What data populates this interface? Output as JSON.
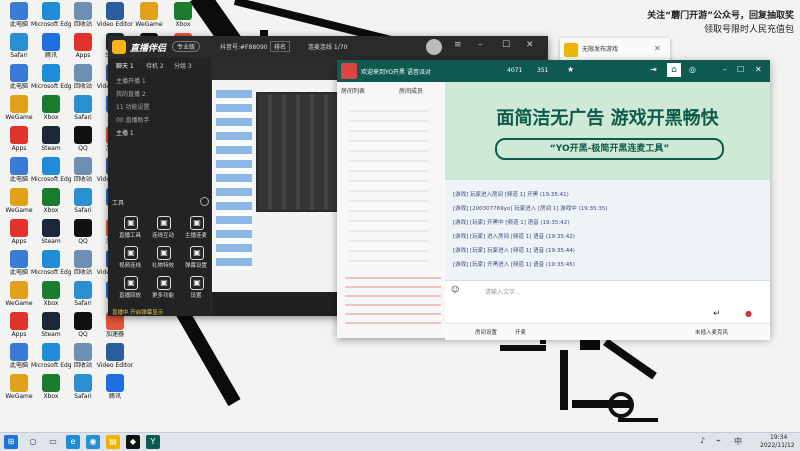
{
  "banner": {
    "line1": "关注“蘑门开游”公众号，回复抽取奖",
    "line2": "领取号限时人民充值包"
  },
  "desktop_icons": [
    {
      "label": "此电脑",
      "icon": "pc-icon",
      "color": "#3a7bd5"
    },
    {
      "label": "Microsoft Edge",
      "icon": "edge-icon",
      "color": "#1e8cd6"
    },
    {
      "label": "回收站",
      "icon": "recycle-bin-icon",
      "color": "#6d8fb3"
    },
    {
      "label": "Video Editor",
      "icon": "video-editor-icon",
      "color": "#2b5d9c"
    },
    {
      "label": "WeGame",
      "icon": "wegame-icon",
      "color": "#e0a21b"
    },
    {
      "label": "Xbox",
      "icon": "xbox-icon",
      "color": "#1b7c2f"
    },
    {
      "label": "Safari",
      "icon": "browser-icon",
      "color": "#2b8fd0"
    },
    {
      "label": "腾讯",
      "icon": "tencent-icon",
      "color": "#1f6fe0"
    },
    {
      "label": "Apps",
      "icon": "apps-icon",
      "color": "#e1322b"
    },
    {
      "label": "Steam",
      "icon": "steam-icon",
      "color": "#1b2838"
    },
    {
      "label": "QQ",
      "icon": "qq-icon",
      "color": "#111"
    },
    {
      "label": "加速器",
      "icon": "accelerator-icon",
      "color": "#e6553a"
    }
  ],
  "main_window": {
    "brand": "直播伴侣",
    "brand_badge": "专业版",
    "tabs": [
      "聊天 1",
      "待机 2",
      "分组 3"
    ],
    "title_info": "抖音号:#F88090",
    "title_tab": "排名",
    "status": "连麦连线 1/70",
    "sidebar_rows": [
      "主播开播 1",
      "我的直播 2",
      "11 功能设置",
      "00 直播助手",
      "主播 1"
    ],
    "section_label": "工具",
    "functions": [
      {
        "label": "直播工具",
        "icon": "tools-icon"
      },
      {
        "label": "连线互动",
        "icon": "link-icon"
      },
      {
        "label": "主播连麦",
        "icon": "mic-icon"
      },
      {
        "label": "视频连线",
        "icon": "video-icon"
      },
      {
        "label": "礼物特效",
        "icon": "gift-icon"
      },
      {
        "label": "弹幕设置",
        "icon": "danmu-icon"
      },
      {
        "label": "直播回放",
        "icon": "replay-icon"
      },
      {
        "label": "更多功能",
        "icon": "more-icon"
      },
      {
        "label": "设置",
        "icon": "settings-icon"
      }
    ],
    "bottom_hint": "直播中 开启弹幕显示",
    "bottom_buttons": [
      "连线",
      "画面",
      "分享"
    ]
  },
  "chat_window": {
    "title": "欢迎来到YO开黑 语音派对",
    "room_id": "4071",
    "online": "351",
    "list_header": "房间列表",
    "list_tab": "房间成员",
    "ad": {
      "headline": "面简洁无广告 游戏开黑畅快",
      "slogan": "“YO开黑-极简开黑连麦工具”"
    },
    "messages": [
      "[游戏] 玩家进入房间 [频道 1] 开黑 (19:35:41)",
      "[游戏] [200307769yo] 玩家进入 [房间 1] 游戏中 (19:35:35)",
      "[游戏] [玩家] 开黑中 [频道 1] 语音 (19:35:42)",
      "[游戏] [玩家] 进入房间 [频道 1] 语音 (19:35:42)",
      "[游戏] [玩家] 玩家进入 [频道 1] 语音 (19:35:44)",
      "[游戏] [玩家] 开黑进入 [频道 1] 语音 (19:35:45)"
    ],
    "input_placeholder": "请输入文字...",
    "bottom_items": [
      "房间设置",
      "开麦"
    ],
    "mic_status": "未插入麦克风"
  },
  "qq_window": {
    "title": "无限发布游戏"
  },
  "taskbar": {
    "time": "19:34",
    "date": "2022/11/12"
  }
}
